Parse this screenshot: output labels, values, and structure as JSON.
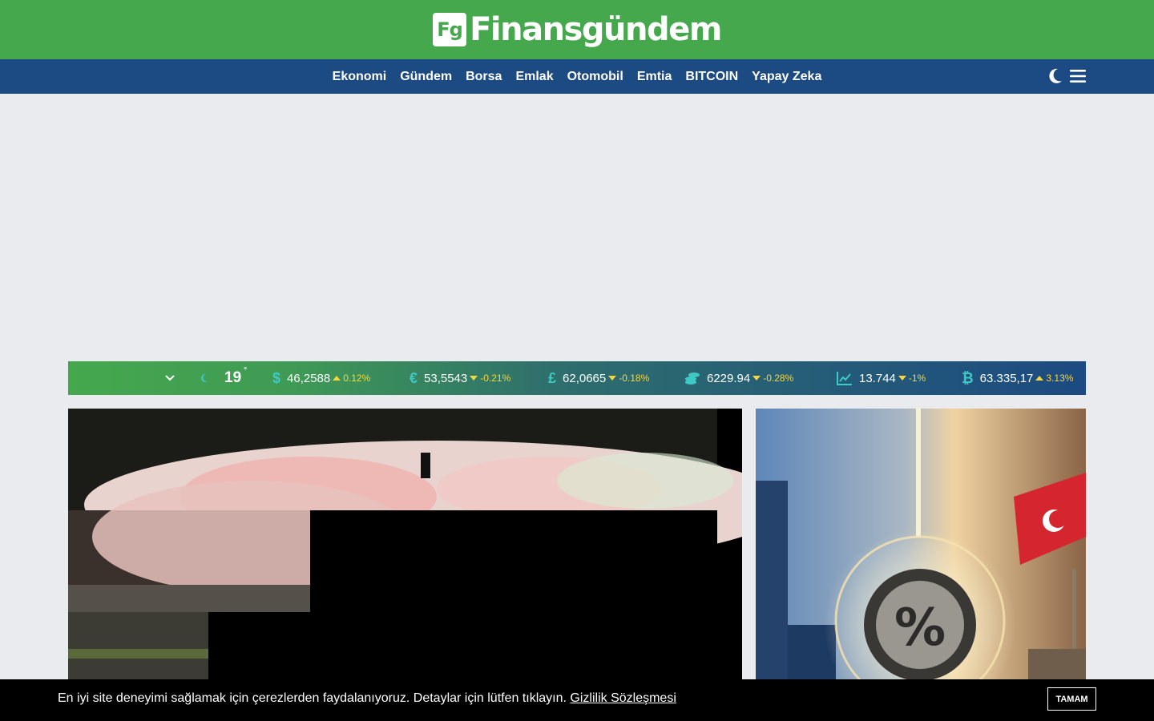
{
  "brand": {
    "logo_mark": "Fg",
    "name": "Finansgündem"
  },
  "nav": {
    "items": [
      {
        "label": "Ekonomi"
      },
      {
        "label": "Gündem"
      },
      {
        "label": "Borsa"
      },
      {
        "label": "Emlak"
      },
      {
        "label": "Otomobil"
      },
      {
        "label": "Emtia"
      },
      {
        "label": "BITCOIN"
      },
      {
        "label": "Yapay Zeka"
      }
    ],
    "tools": {
      "theme_icon": "moon-icon",
      "menu_icon": "hamburger-menu-icon"
    }
  },
  "ticker": {
    "weather": {
      "icon": "moon-small-icon",
      "temp": "19",
      "unit": "°"
    },
    "items": [
      {
        "name": "usd",
        "icon": "dollar-icon",
        "symbol": "$",
        "value": "46,2588",
        "change": "0.12%",
        "direction": "up"
      },
      {
        "name": "eur",
        "icon": "euro-icon",
        "symbol": "€",
        "value": "53,5543",
        "change": "-0.21%",
        "direction": "down"
      },
      {
        "name": "gbp",
        "icon": "pound-icon",
        "symbol": "£",
        "value": "62,0665",
        "change": "-0.18%",
        "direction": "down"
      },
      {
        "name": "gold",
        "icon": "coins-icon",
        "symbol": "",
        "value": "6229.94",
        "change": "-0.28%",
        "direction": "down"
      },
      {
        "name": "bist",
        "icon": "chart-line-icon",
        "symbol": "",
        "value": "13.744",
        "change": "-1%",
        "direction": "down"
      },
      {
        "name": "btc",
        "icon": "bitcoin-icon",
        "symbol": "₿",
        "value": "63.335,17",
        "change": "3.13%",
        "direction": "up"
      }
    ],
    "colors": {
      "icon": "#3ec9c6",
      "change": "#f5d63d"
    }
  },
  "cookie": {
    "text": "En iyi site deneyimi sağlamak için çerezlerden faydalanıyoruz. Detaylar için lütfen tıklayın. ",
    "link": "Gizlilik Sözleşmesi",
    "button": "TAMAM"
  },
  "colors": {
    "topbar": "#45a84d",
    "navbar": "#1c4a82",
    "page_bg": "#e9ebef"
  }
}
